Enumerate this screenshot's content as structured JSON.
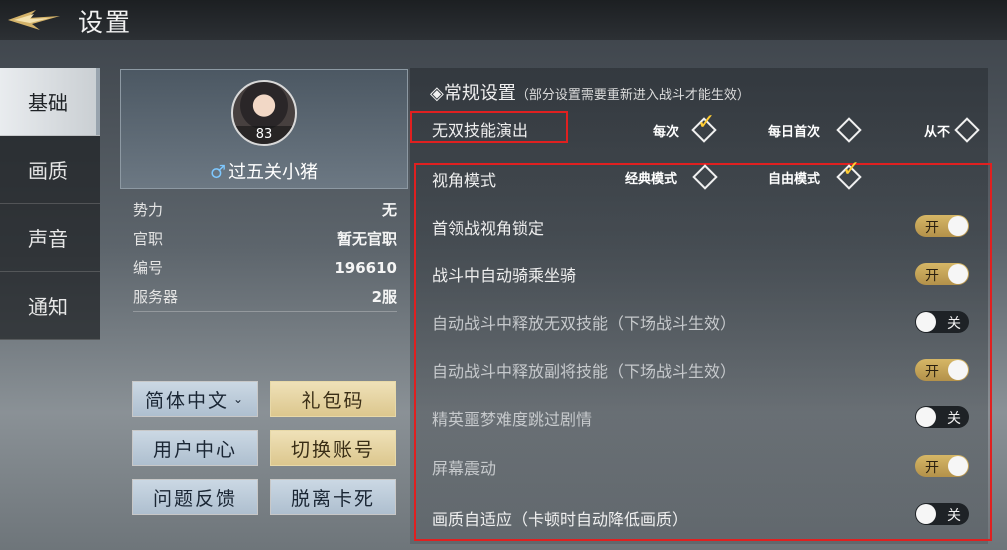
{
  "header": {
    "title": "设置"
  },
  "tabs": [
    {
      "label": "基础",
      "active": true
    },
    {
      "label": "画质",
      "active": false
    },
    {
      "label": "声音",
      "active": false
    },
    {
      "label": "通知",
      "active": false
    }
  ],
  "profile": {
    "level": "83",
    "gender_symbol": "♂",
    "name": "过五关小猪",
    "info": [
      {
        "key": "势力",
        "value": "无"
      },
      {
        "key": "官职",
        "value": "暂无官职"
      },
      {
        "key": "编号",
        "value": "196610"
      },
      {
        "key": "服务器",
        "value": "2服"
      }
    ]
  },
  "buttons": {
    "language": "简体中文",
    "gift_code": "礼包码",
    "user_center": "用户中心",
    "switch_account": "切换账号",
    "feedback": "问题反馈",
    "unstuck": "脱离卡死"
  },
  "settings": {
    "section_title": "◈常规设置",
    "section_note": "（部分设置需要重新进入战斗才能生效）",
    "skill_anim": {
      "label": "无双技能演出",
      "options": [
        "每次",
        "每日首次",
        "从不"
      ],
      "selected": "每次"
    },
    "camera": {
      "label": "视角模式",
      "options": [
        "经典模式",
        "自由模式"
      ],
      "selected": "自由模式"
    },
    "toggles": [
      {
        "label": "首领战视角锁定",
        "on": true,
        "text": "开",
        "dim": false
      },
      {
        "label": "战斗中自动骑乘坐骑",
        "on": true,
        "text": "开",
        "dim": false
      },
      {
        "label": "自动战斗中释放无双技能（下场战斗生效）",
        "on": false,
        "text": "关",
        "dim": true
      },
      {
        "label": "自动战斗中释放副将技能（下场战斗生效）",
        "on": true,
        "text": "开",
        "dim": true
      },
      {
        "label": "精英噩梦难度跳过剧情",
        "on": false,
        "text": "关",
        "dim": true
      },
      {
        "label": "屏幕震动",
        "on": true,
        "text": "开",
        "dim": true
      },
      {
        "label": "画质自适应（卡顿时自动降低画质）",
        "on": false,
        "text": "关",
        "dim": false
      }
    ]
  },
  "colors": {
    "highlight_box": "#e02020",
    "toggle_on": "#d6b766",
    "toggle_off": "#1e2226",
    "check": "#ffcc33"
  }
}
